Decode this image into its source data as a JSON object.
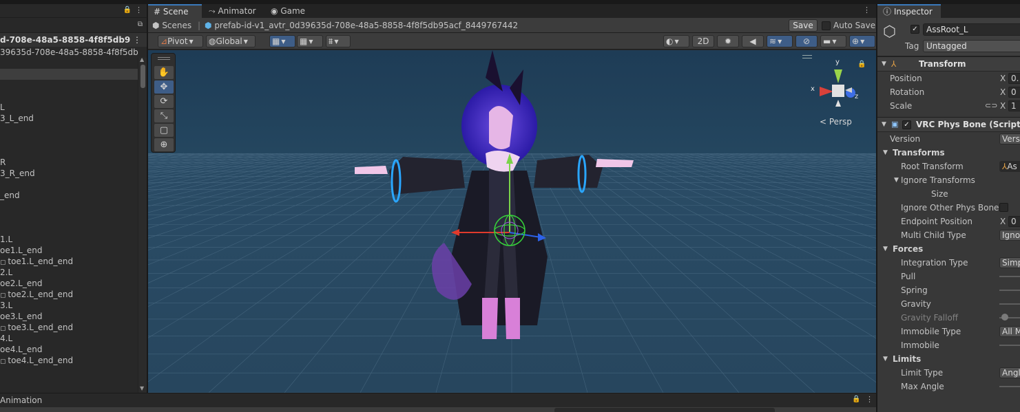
{
  "hierarchy": {
    "scene_name": "d-708e-48a5-8858-4f8f5db9",
    "rows": [
      {
        "text": "39635d-708e-48a5-8858-4f8f5db",
        "indent": 0
      },
      {
        "text": "",
        "indent": 0
      },
      {
        "text": "",
        "indent": 0
      },
      {
        "text": "",
        "indent": 0
      },
      {
        "text": "",
        "indent": 0
      },
      {
        "text": "L",
        "indent": 0
      },
      {
        "text": "3_L_end",
        "indent": 0
      },
      {
        "text": "",
        "indent": 0
      },
      {
        "text": "",
        "indent": 0
      },
      {
        "text": "",
        "indent": 0
      },
      {
        "text": "R",
        "indent": 0
      },
      {
        "text": "3_R_end",
        "indent": 0
      },
      {
        "text": "",
        "indent": 0
      },
      {
        "text": "_end",
        "indent": 0
      },
      {
        "text": "",
        "indent": 0
      },
      {
        "text": "",
        "indent": 0
      },
      {
        "text": "",
        "indent": 0
      },
      {
        "text": "1.L",
        "indent": 0
      },
      {
        "text": "oe1.L_end",
        "indent": 0
      },
      {
        "text": "toe1.L_end_end",
        "indent": 1
      },
      {
        "text": "2.L",
        "indent": 0
      },
      {
        "text": "oe2.L_end",
        "indent": 0
      },
      {
        "text": "toe2.L_end_end",
        "indent": 1
      },
      {
        "text": "3.L",
        "indent": 0
      },
      {
        "text": "oe3.L_end",
        "indent": 0
      },
      {
        "text": "toe3.L_end_end",
        "indent": 1
      },
      {
        "text": "4.L",
        "indent": 0
      },
      {
        "text": "oe4.L_end",
        "indent": 0
      },
      {
        "text": "toe4.L_end_end",
        "indent": 1
      }
    ]
  },
  "scene_view": {
    "tabs": [
      {
        "label": "Scene",
        "icon": "#"
      },
      {
        "label": "Animator",
        "icon": "⤳"
      },
      {
        "label": "Game",
        "icon": "◉"
      }
    ],
    "breadcrumb": {
      "root": "Scenes",
      "prefab": "prefab-id-v1_avtr_0d39635d-708e-48a5-8858-4f8f5db95acf_8449767442"
    },
    "save_label": "Save",
    "autosave_label": "Auto Save",
    "toolbar": {
      "pivot_label": "Pivot",
      "global_label": "Global",
      "mode_2d_label": "2D"
    },
    "persp_label": "Persp",
    "gizmo_axes": {
      "x": "x",
      "y": "y",
      "z": "z"
    }
  },
  "inspector": {
    "tab_label": "Inspector",
    "object_name": "AssRoot_L",
    "tag_label": "Tag",
    "tag_value": "Untagged",
    "transform": {
      "title": "Transform",
      "rows": [
        {
          "label": "Position",
          "axis": "X",
          "value": "0."
        },
        {
          "label": "Rotation",
          "axis": "X",
          "value": "0"
        },
        {
          "label": "Scale",
          "axis": "X",
          "value": "1"
        }
      ]
    },
    "physbone": {
      "title": "VRC Phys Bone (Script)",
      "version_label": "Version",
      "version_value": "Versi",
      "transforms_label": "Transforms",
      "root_transform_label": "Root Transform",
      "root_transform_value": "As",
      "ignore_transforms_label": "Ignore Transforms",
      "size_label": "Size",
      "ignore_other_label": "Ignore Other Phys Bones",
      "endpoint_label": "Endpoint Position",
      "endpoint_axis": "X",
      "endpoint_value": "0",
      "multi_child_label": "Multi Child Type",
      "multi_child_value": "Ignor",
      "forces_label": "Forces",
      "integration_label": "Integration Type",
      "integration_value": "Simp",
      "pull_label": "Pull",
      "spring_label": "Spring",
      "gravity_label": "Gravity",
      "gravity_falloff_label": "Gravity Falloff",
      "immobile_type_label": "Immobile Type",
      "immobile_type_value": "All M",
      "immobile_label": "Immobile",
      "limits_label": "Limits",
      "limit_type_label": "Limit Type",
      "limit_type_value": "Angl",
      "max_angle_label": "Max Angle"
    }
  },
  "animation": {
    "title": "Animation"
  }
}
